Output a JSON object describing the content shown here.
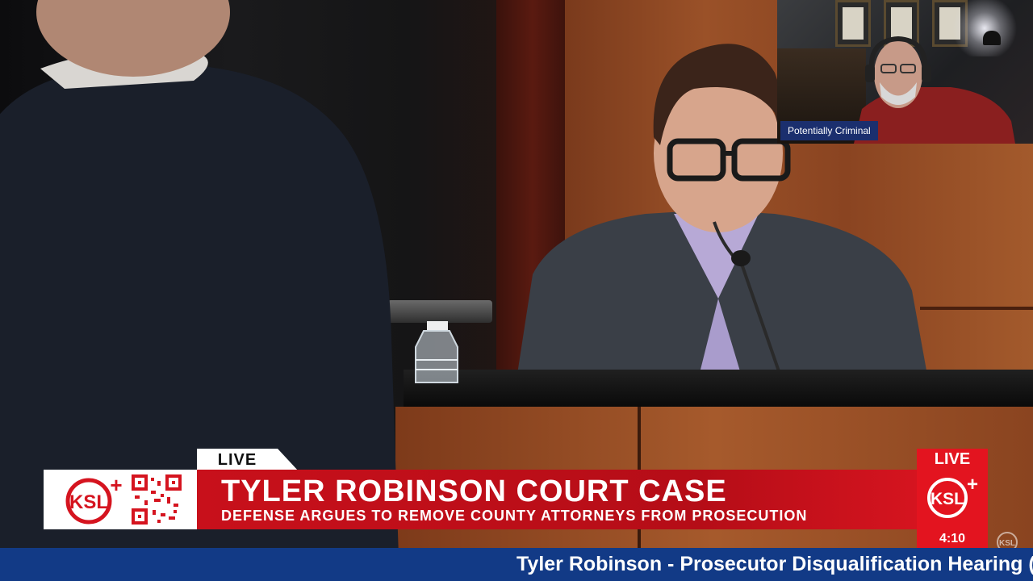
{
  "stream": {
    "live_left": "LIVE",
    "live_right": "LIVE",
    "channel_logo": "KSL+",
    "clock": "4:10"
  },
  "lower_third": {
    "headline": "TYLER ROBINSON COURT CASE",
    "subheadline": "DEFENSE ARGUES TO REMOVE COUNTY ATTORNEYS FROM PROSECUTION"
  },
  "ticker": {
    "text": "Tyler Robinson - Prosecutor Disqualification Hearing ("
  },
  "pip": {
    "label": "Potentially Criminal"
  },
  "colors": {
    "brand_red": "#e3141f",
    "ticker_blue": "#123a86",
    "pip_label_blue": "#1b2f6e"
  },
  "icons": [
    "ksl-plus-logo",
    "qr-code-icon",
    "ksl-watermark-icon"
  ]
}
